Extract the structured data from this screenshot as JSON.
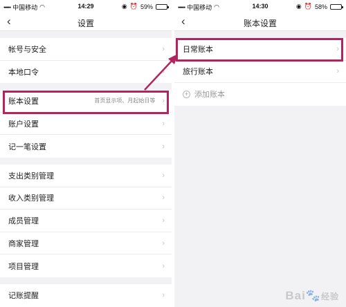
{
  "left_screen": {
    "status": {
      "carrier": "中国移动",
      "time": "14:29",
      "battery": "59%"
    },
    "title": "设置",
    "groups": [
      [
        {
          "label": "帐号与安全"
        },
        {
          "label": "本地口令"
        }
      ],
      [
        {
          "label": "账本设置",
          "hint": "首页显示项、月起始日等"
        },
        {
          "label": "账户设置"
        },
        {
          "label": "记一笔设置"
        }
      ],
      [
        {
          "label": "支出类别管理"
        },
        {
          "label": "收入类别管理"
        },
        {
          "label": "成员管理"
        },
        {
          "label": "商家管理"
        },
        {
          "label": "项目管理"
        }
      ],
      [
        {
          "label": "记账提醒"
        }
      ]
    ]
  },
  "right_screen": {
    "status": {
      "carrier": "中国移动",
      "time": "14:30",
      "battery": "58%"
    },
    "title": "账本设置",
    "items": [
      {
        "label": "日常账本"
      },
      {
        "label": "旅行账本"
      }
    ],
    "add_label": "添加账本"
  },
  "highlight_color": "#b3245e",
  "watermark": {
    "logo": "Bai",
    "text": "经验"
  }
}
